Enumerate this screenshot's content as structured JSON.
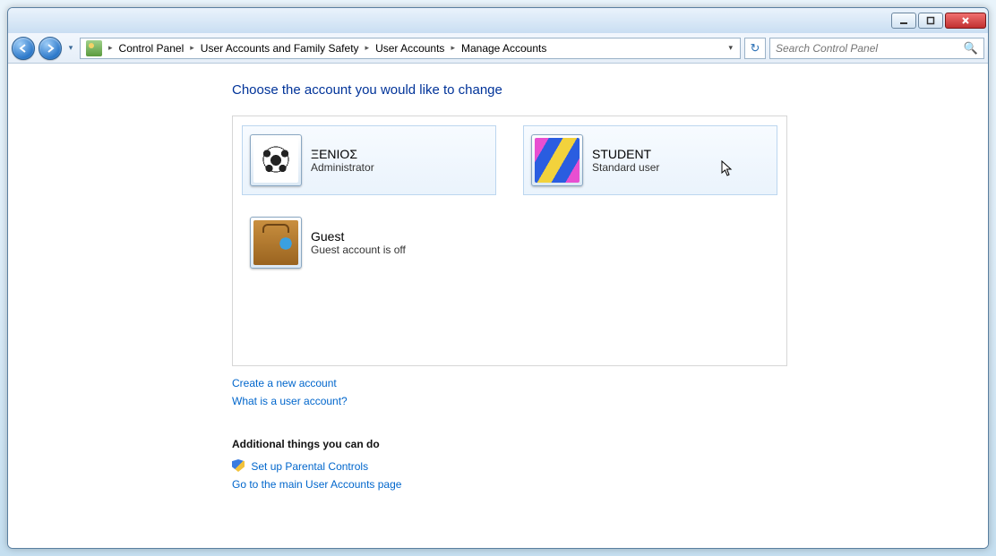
{
  "breadcrumb": {
    "items": [
      "Control Panel",
      "User Accounts and Family Safety",
      "User Accounts",
      "Manage Accounts"
    ]
  },
  "search": {
    "placeholder": "Search Control Panel"
  },
  "heading": "Choose the account you would like to change",
  "accounts": [
    {
      "name": "ΞΕΝΙΟΣ",
      "role": "Administrator",
      "avatar": "soccer",
      "highlighted": true
    },
    {
      "name": "STUDENT",
      "role": "Standard user",
      "avatar": "fabric",
      "highlighted": true,
      "cursor": true
    },
    {
      "name": "Guest",
      "role": "Guest account is off",
      "avatar": "suitcase",
      "highlighted": false
    }
  ],
  "links": {
    "create": "Create a new account",
    "whatis": "What is a user account?"
  },
  "additional": {
    "heading": "Additional things you can do",
    "parental": "Set up Parental Controls",
    "mainpage": "Go to the main User Accounts page"
  }
}
